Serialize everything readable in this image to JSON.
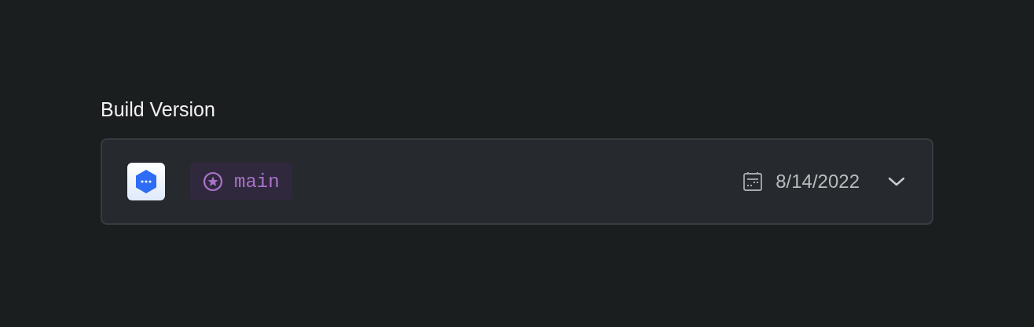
{
  "label": "Build Version",
  "select": {
    "branch": "main",
    "date": "8/14/2022",
    "expanded": false
  }
}
